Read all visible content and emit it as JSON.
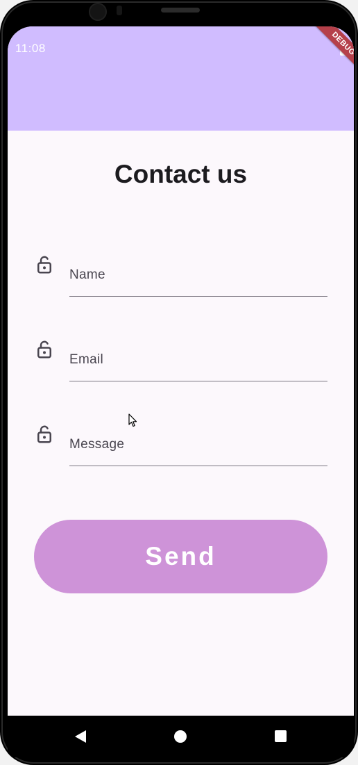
{
  "status_bar": {
    "time": "11:08"
  },
  "debug_banner": {
    "label": "DEBUG"
  },
  "page": {
    "title": "Contact us"
  },
  "form": {
    "fields": [
      {
        "placeholder": "Name",
        "value": "",
        "icon": "lock-open-icon"
      },
      {
        "placeholder": "Email",
        "value": "",
        "icon": "lock-open-icon"
      },
      {
        "placeholder": "Message",
        "value": "",
        "icon": "lock-open-icon"
      }
    ],
    "send_label": "Send"
  },
  "colors": {
    "app_bar": "#d0bcff",
    "background": "#fcf8fc",
    "send_button": "#ce93d8",
    "debug_banner": "#b5404a",
    "text": "#1c1b1f"
  },
  "nav_bar": {
    "icons": [
      "back-icon",
      "home-icon",
      "recents-icon"
    ]
  }
}
